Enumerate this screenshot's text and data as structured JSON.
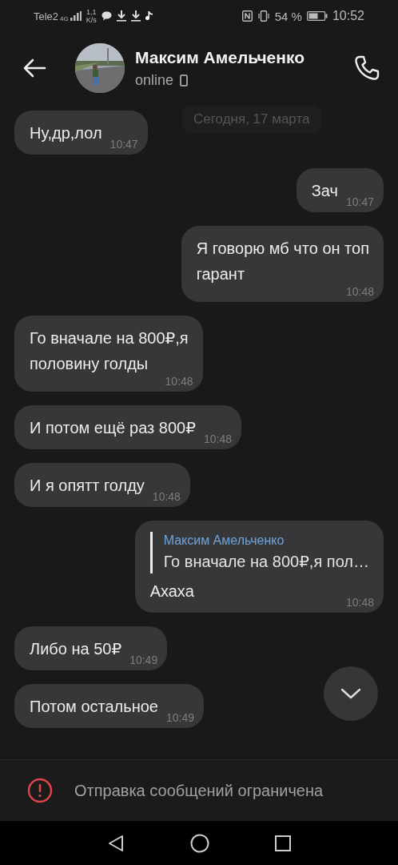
{
  "status_bar": {
    "carrier": "Tele2",
    "network": "4G",
    "speed": [
      "1,1",
      "K/s"
    ],
    "battery_percent": "54 %",
    "time": "10:52"
  },
  "header": {
    "name": "Максим Амельченко",
    "status": "online"
  },
  "date_divider": "Сегодня, 17 марта",
  "messages": [
    {
      "kind": "incoming",
      "lines": [
        "Ну,др,лол"
      ],
      "time": "10:47"
    },
    {
      "kind": "outgoing",
      "lines": [
        "Зач"
      ],
      "time": "10:47"
    },
    {
      "kind": "outgoing",
      "lines": [
        "Я говорю мб что он топ",
        "гарант"
      ],
      "time": "10:48"
    },
    {
      "kind": "incoming",
      "lines": [
        "Го вначале на 800₽,я",
        "половину голды"
      ],
      "time": "10:48"
    },
    {
      "kind": "incoming",
      "lines": [
        "И потом ещё раз 800₽"
      ],
      "time": "10:48"
    },
    {
      "kind": "incoming",
      "lines": [
        "И я опятт голду"
      ],
      "time": "10:48"
    },
    {
      "kind": "outgoing",
      "reply": {
        "author": "Максим Амельченко",
        "text": "Го вначале на 800₽,я пол…"
      },
      "lines": [
        "Ахаха"
      ],
      "time": "10:48"
    },
    {
      "kind": "incoming",
      "lines": [
        "Либо на 50₽"
      ],
      "time": "10:49"
    },
    {
      "kind": "incoming",
      "lines": [
        "Потом остальное"
      ],
      "time": "10:49"
    }
  ],
  "notice": "Отправка сообщений ограничена"
}
